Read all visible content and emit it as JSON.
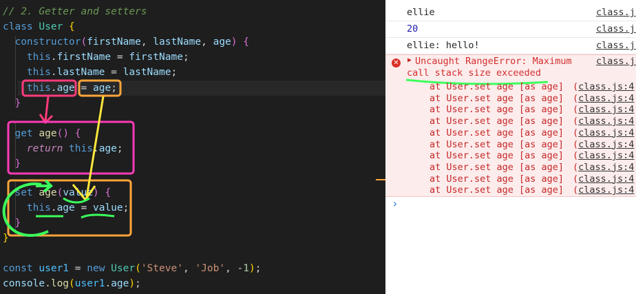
{
  "editor": {
    "lines": [
      [
        {
          "t": "// 2. Getter and setters",
          "c": "k-cmt"
        }
      ],
      [
        {
          "t": "class ",
          "c": "k-kw"
        },
        {
          "t": "User ",
          "c": "k-cls"
        },
        {
          "t": "{",
          "c": "k-br1"
        }
      ],
      [
        {
          "t": "  "
        },
        {
          "t": "constructor",
          "c": "k-kw"
        },
        {
          "t": "(",
          "c": "k-br2"
        },
        {
          "t": "firstName",
          "c": "k-var"
        },
        {
          "t": ", "
        },
        {
          "t": "lastName",
          "c": "k-var"
        },
        {
          "t": ", "
        },
        {
          "t": "age",
          "c": "k-var"
        },
        {
          "t": ")",
          "c": "k-br2"
        },
        {
          "t": " "
        },
        {
          "t": "{",
          "c": "k-br2"
        }
      ],
      [
        {
          "t": "    "
        },
        {
          "t": "this",
          "c": "k-kw"
        },
        {
          "t": "."
        },
        {
          "t": "firstName",
          "c": "k-prop"
        },
        {
          "t": " = "
        },
        {
          "t": "firstName",
          "c": "k-var"
        },
        {
          "t": ";"
        }
      ],
      [
        {
          "t": "    "
        },
        {
          "t": "this",
          "c": "k-kw"
        },
        {
          "t": "."
        },
        {
          "t": "lastName",
          "c": "k-prop"
        },
        {
          "t": " = "
        },
        {
          "t": "lastName",
          "c": "k-var"
        },
        {
          "t": ";"
        }
      ],
      [
        {
          "t": "    "
        },
        {
          "t": "this",
          "c": "k-kw"
        },
        {
          "t": "."
        },
        {
          "t": "age",
          "c": "k-prop"
        },
        {
          "t": " = "
        },
        {
          "t": "age",
          "c": "k-var"
        },
        {
          "t": ";"
        }
      ],
      [
        {
          "t": "  "
        },
        {
          "t": "}",
          "c": "k-br2"
        }
      ],
      [
        {
          "t": ""
        }
      ],
      [
        {
          "t": "  "
        },
        {
          "t": "get ",
          "c": "k-kw"
        },
        {
          "t": "age",
          "c": "k-fn"
        },
        {
          "t": "()",
          "c": "k-br2"
        },
        {
          "t": " "
        },
        {
          "t": "{",
          "c": "k-br2"
        }
      ],
      [
        {
          "t": "    "
        },
        {
          "t": "return ",
          "c": "k-ctl"
        },
        {
          "t": "this",
          "c": "k-kw"
        },
        {
          "t": "."
        },
        {
          "t": "age",
          "c": "k-prop"
        },
        {
          "t": ";"
        }
      ],
      [
        {
          "t": "  "
        },
        {
          "t": "}",
          "c": "k-br2"
        }
      ],
      [
        {
          "t": ""
        }
      ],
      [
        {
          "t": "  "
        },
        {
          "t": "set ",
          "c": "k-kw"
        },
        {
          "t": "age",
          "c": "k-fn"
        },
        {
          "t": "(",
          "c": "k-br2"
        },
        {
          "t": "value",
          "c": "k-var"
        },
        {
          "t": ")",
          "c": "k-br2"
        },
        {
          "t": " "
        },
        {
          "t": "{",
          "c": "k-br2"
        }
      ],
      [
        {
          "t": "    "
        },
        {
          "t": "this",
          "c": "k-kw"
        },
        {
          "t": "."
        },
        {
          "t": "age",
          "c": "k-prop"
        },
        {
          "t": " = "
        },
        {
          "t": "value",
          "c": "k-var"
        },
        {
          "t": ";"
        }
      ],
      [
        {
          "t": "  "
        },
        {
          "t": "}",
          "c": "k-br2"
        }
      ],
      [
        {
          "t": "}",
          "c": "k-br1"
        }
      ],
      [
        {
          "t": ""
        }
      ],
      [
        {
          "t": "const ",
          "c": "k-kw"
        },
        {
          "t": "user1",
          "c": "k-const"
        },
        {
          "t": " = "
        },
        {
          "t": "new ",
          "c": "k-kw"
        },
        {
          "t": "User",
          "c": "k-cls"
        },
        {
          "t": "(",
          "c": "k-br1"
        },
        {
          "t": "'Steve'",
          "c": "k-str"
        },
        {
          "t": ", "
        },
        {
          "t": "'Job'",
          "c": "k-str"
        },
        {
          "t": ", -"
        },
        {
          "t": "1",
          "c": "k-num"
        },
        {
          "t": ")",
          "c": "k-br1"
        },
        {
          "t": ";"
        }
      ],
      [
        {
          "t": "console",
          "c": "k-var"
        },
        {
          "t": "."
        },
        {
          "t": "log",
          "c": "k-fn"
        },
        {
          "t": "(",
          "c": "k-br1"
        },
        {
          "t": "user1",
          "c": "k-const"
        },
        {
          "t": "."
        },
        {
          "t": "age",
          "c": "k-prop"
        },
        {
          "t": ")",
          "c": "k-br1"
        },
        {
          "t": ";"
        }
      ]
    ]
  },
  "console": {
    "logs": [
      {
        "message": "ellie",
        "source": "class.js"
      },
      {
        "message": "20",
        "source": "class.js",
        "numeric": true
      },
      {
        "message": "ellie: hello!",
        "source": "class.js"
      }
    ],
    "error": {
      "line1": "Uncaught RangeError: Maximum",
      "line2": "call stack size exceeded",
      "source": "class.js",
      "icon": "error-circle-icon"
    },
    "stack": [
      {
        "text": "at User.set age [as age]",
        "source": "class.js:4"
      },
      {
        "text": "at User.set age [as age]",
        "source": "class.js:4"
      },
      {
        "text": "at User.set age [as age]",
        "source": "class.js:4"
      },
      {
        "text": "at User.set age [as age]",
        "source": "class.js:4"
      },
      {
        "text": "at User.set age [as age]",
        "source": "class.js:4"
      },
      {
        "text": "at User.set age [as age]",
        "source": "class.js:4"
      },
      {
        "text": "at User.set age [as age]",
        "source": "class.js:4"
      },
      {
        "text": "at User.set age [as age]",
        "source": "class.js:4"
      },
      {
        "text": "at User.set age [as age]",
        "source": "class.js:4"
      },
      {
        "text": "at User.set age [as age]",
        "source": "class.js:4"
      }
    ],
    "prompt": "›"
  },
  "colors": {
    "annot_pink": "#ff3b7a",
    "annot_orange": "#ffa53b",
    "annot_yellow": "#ffe83b",
    "annot_green": "#3bff5c",
    "annot_magenta": "#ff3bb8"
  }
}
